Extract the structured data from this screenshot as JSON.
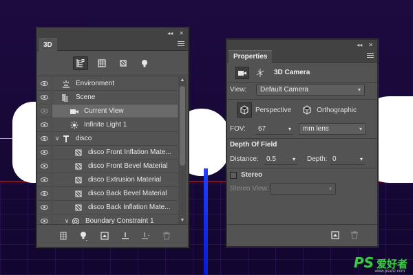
{
  "panel3d": {
    "tab_label": "3D",
    "filters": [
      "whole-scene-icon",
      "meshes-icon",
      "materials-icon",
      "lights-icon"
    ],
    "layers": [
      {
        "label": "Environment",
        "icon": "environment-icon",
        "eye": true,
        "twisty": "",
        "indent": 0
      },
      {
        "label": "Scene",
        "icon": "scene-icon",
        "eye": true,
        "twisty": "",
        "indent": 0
      },
      {
        "label": "Current View",
        "icon": "camera-icon",
        "eye": false,
        "twisty": "",
        "indent": 1,
        "selected": true
      },
      {
        "label": "Infinite Light 1",
        "icon": "light-icon",
        "eye": true,
        "twisty": "",
        "indent": 1
      },
      {
        "label": "disco",
        "icon": "mesh-icon",
        "eye": true,
        "twisty": "∨",
        "indent": 1
      },
      {
        "label": "disco Front Inflation Mate...",
        "icon": "material-icon",
        "eye": true,
        "twisty": "",
        "indent": 2
      },
      {
        "label": "disco Front Bevel Material",
        "icon": "material-icon",
        "eye": true,
        "twisty": "",
        "indent": 2
      },
      {
        "label": "disco Extrusion Material",
        "icon": "material-icon",
        "eye": true,
        "twisty": "",
        "indent": 2
      },
      {
        "label": "disco Back Bevel Material",
        "icon": "material-icon",
        "eye": true,
        "twisty": "",
        "indent": 2
      },
      {
        "label": "disco Back Inflation Mate...",
        "icon": "material-icon",
        "eye": true,
        "twisty": "",
        "indent": 2
      },
      {
        "label": "Boundary Constraint 1",
        "icon": "constraint-icon",
        "eye": true,
        "twisty": "∨",
        "indent": 2
      }
    ],
    "bottom_buttons": [
      "mesh-icon",
      "light-dropdown-icon",
      "render-icon",
      "drop-to-plane-icon",
      "constraint-icon",
      "trash-icon"
    ]
  },
  "properties": {
    "tab_label": "Properties",
    "title": "3D Camera",
    "view_label": "View:",
    "view_value": "Default Camera",
    "perspective_label": "Perspective",
    "orthographic_label": "Orthographic",
    "fov_label": "FOV:",
    "fov_value": "67",
    "lens_value": "mm lens",
    "dof_title": "Depth Of Field",
    "distance_label": "Distance:",
    "distance_value": "0.5",
    "depth_label": "Depth:",
    "depth_value": "0",
    "stereo_label": "Stereo",
    "stereo_view_label": "Stereo View:",
    "stereo_view_value": ""
  },
  "watermark": {
    "brand": "PS",
    "chinese": "爱好者",
    "url": "www.psahz.com"
  },
  "colors": {
    "panel_bg": "#535353",
    "panel_dark": "#424242",
    "selected_row": "#6a6a6a",
    "watermark_green": "#3ec84a"
  }
}
